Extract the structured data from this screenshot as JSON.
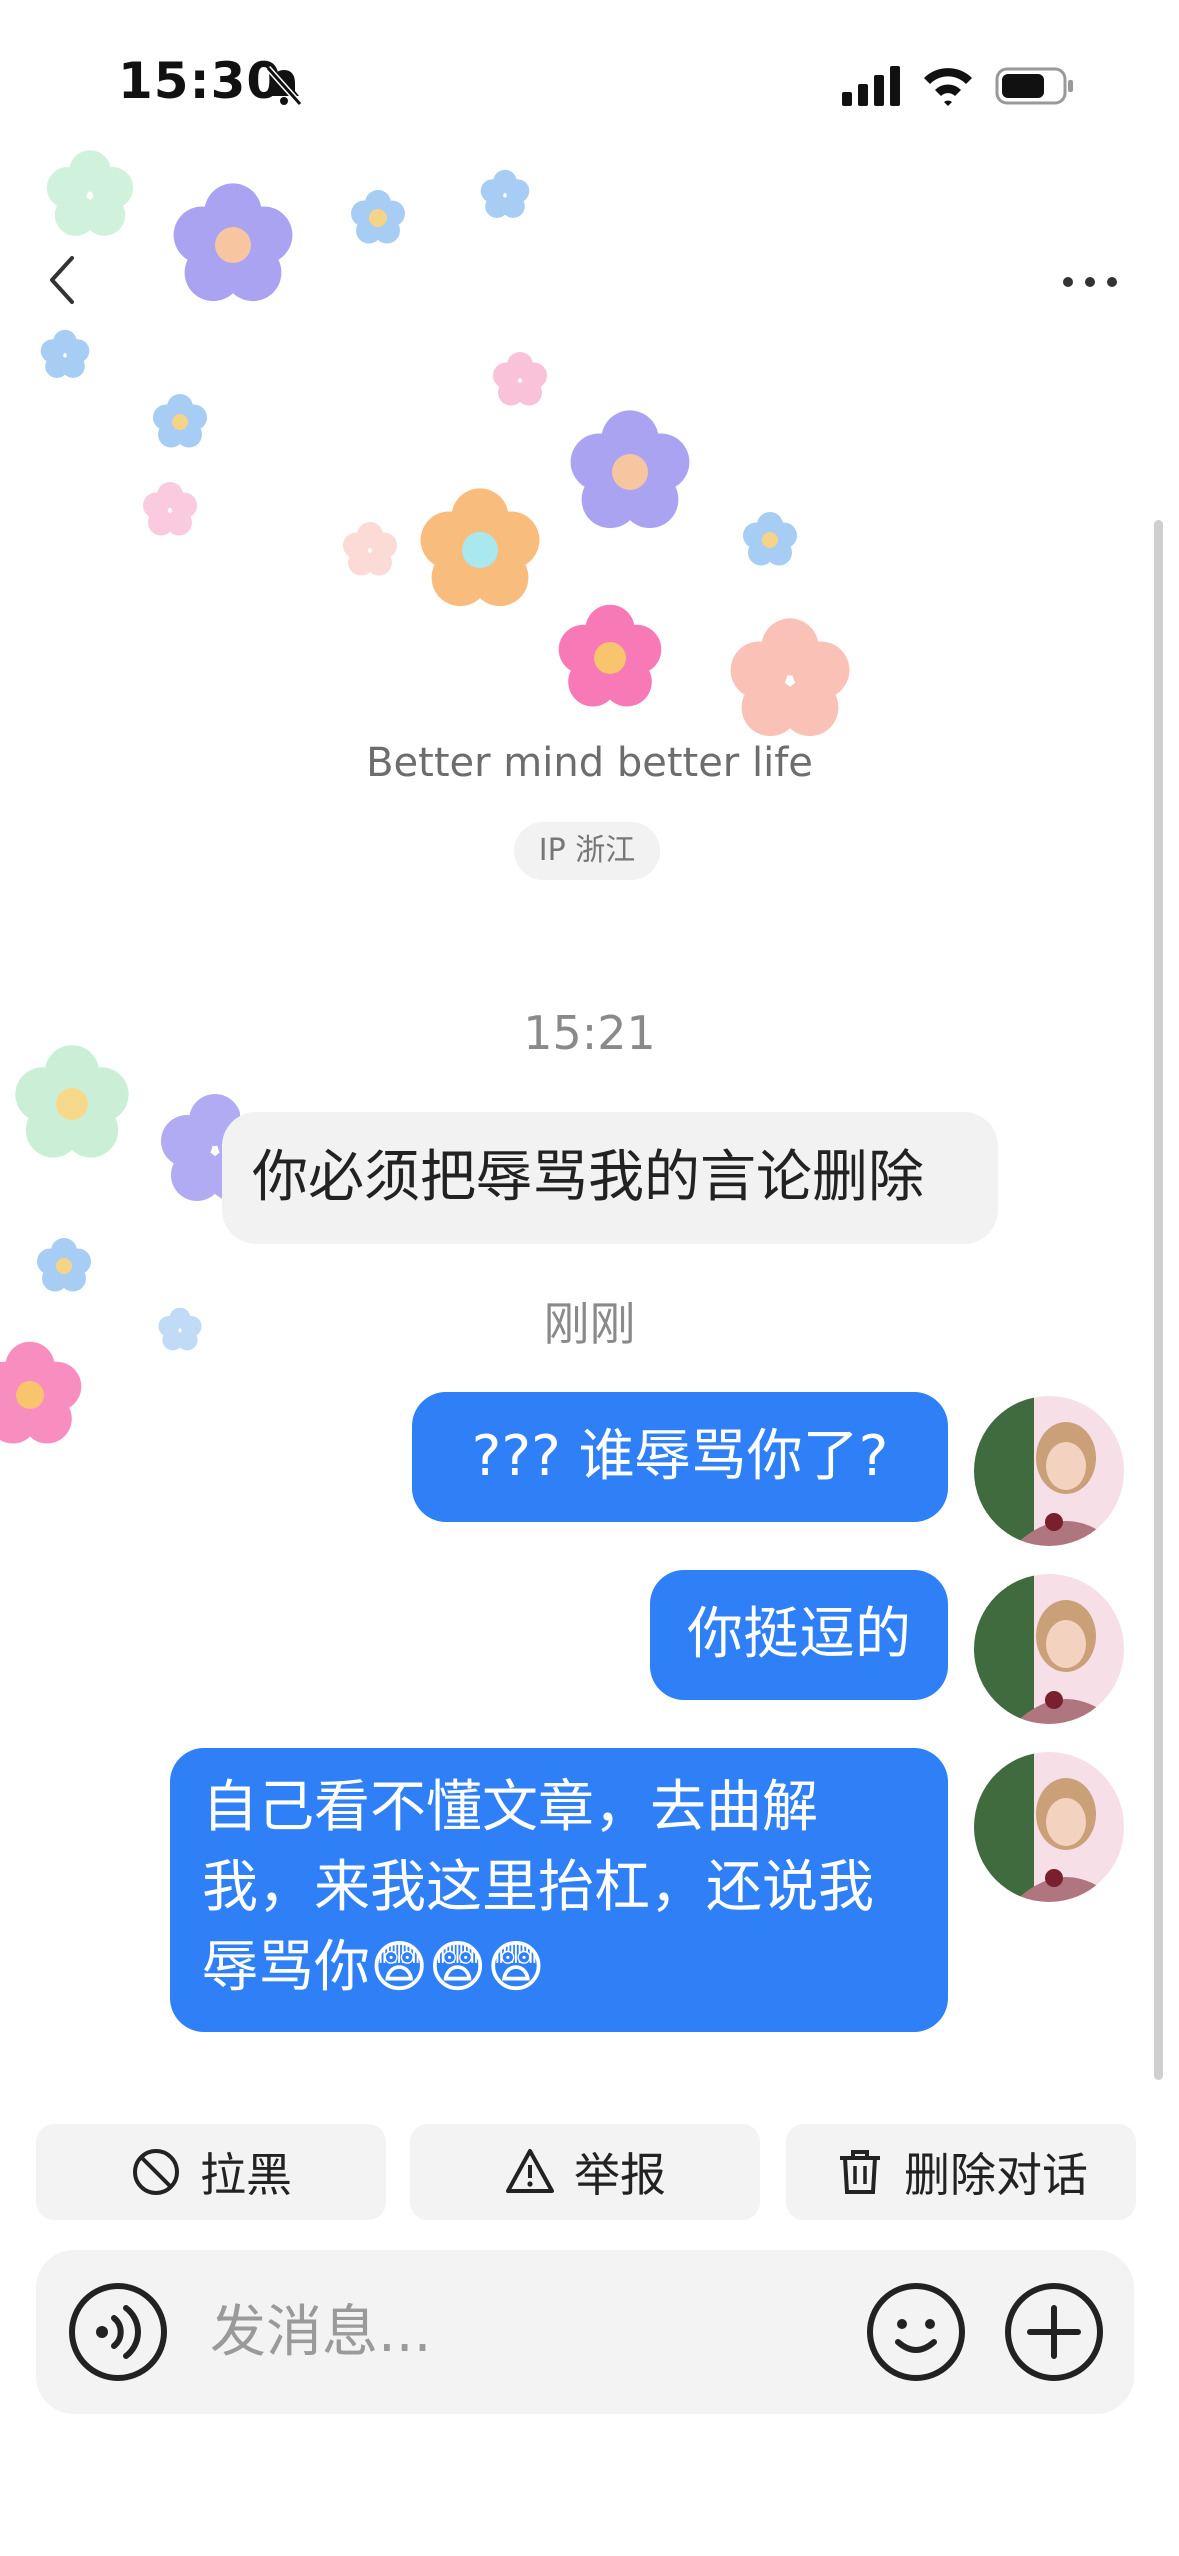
{
  "status_bar": {
    "time": "15:30",
    "icons": [
      "bell-off-icon",
      "signal-icon",
      "wifi-icon",
      "battery-icon"
    ]
  },
  "nav": {
    "back_icon": "chevron-left-icon",
    "more_icon": "more-dots-icon"
  },
  "profile": {
    "bio": "Better mind better life",
    "ip": "IP 浙江"
  },
  "messages": [
    {
      "type": "timestamp",
      "text": "15:21"
    },
    {
      "type": "incoming",
      "text": "你必须把辱骂我的言论删除"
    },
    {
      "type": "timestamp",
      "text": "刚刚"
    },
    {
      "type": "outgoing",
      "text": "??? 谁辱骂你了?"
    },
    {
      "type": "outgoing",
      "text": "你挺逗的"
    },
    {
      "type": "outgoing",
      "lines": [
        "自己看不懂文章，去曲解",
        "我，来我这里抬杠，还说我",
        "辱骂你"
      ],
      "emoji": "😨😨😨"
    }
  ],
  "actions": [
    {
      "label": "拉黑",
      "icon": "block-icon"
    },
    {
      "label": "举报",
      "icon": "warning-icon"
    },
    {
      "label": "删除对话",
      "icon": "trash-icon"
    }
  ],
  "composer": {
    "placeholder": "发消息...",
    "voice_icon": "voice-icon",
    "emoji_icon": "smiley-icon",
    "add_icon": "plus-icon"
  },
  "colors": {
    "accent": "#2f7ff7",
    "incoming_bubble": "#f2f2f2"
  }
}
